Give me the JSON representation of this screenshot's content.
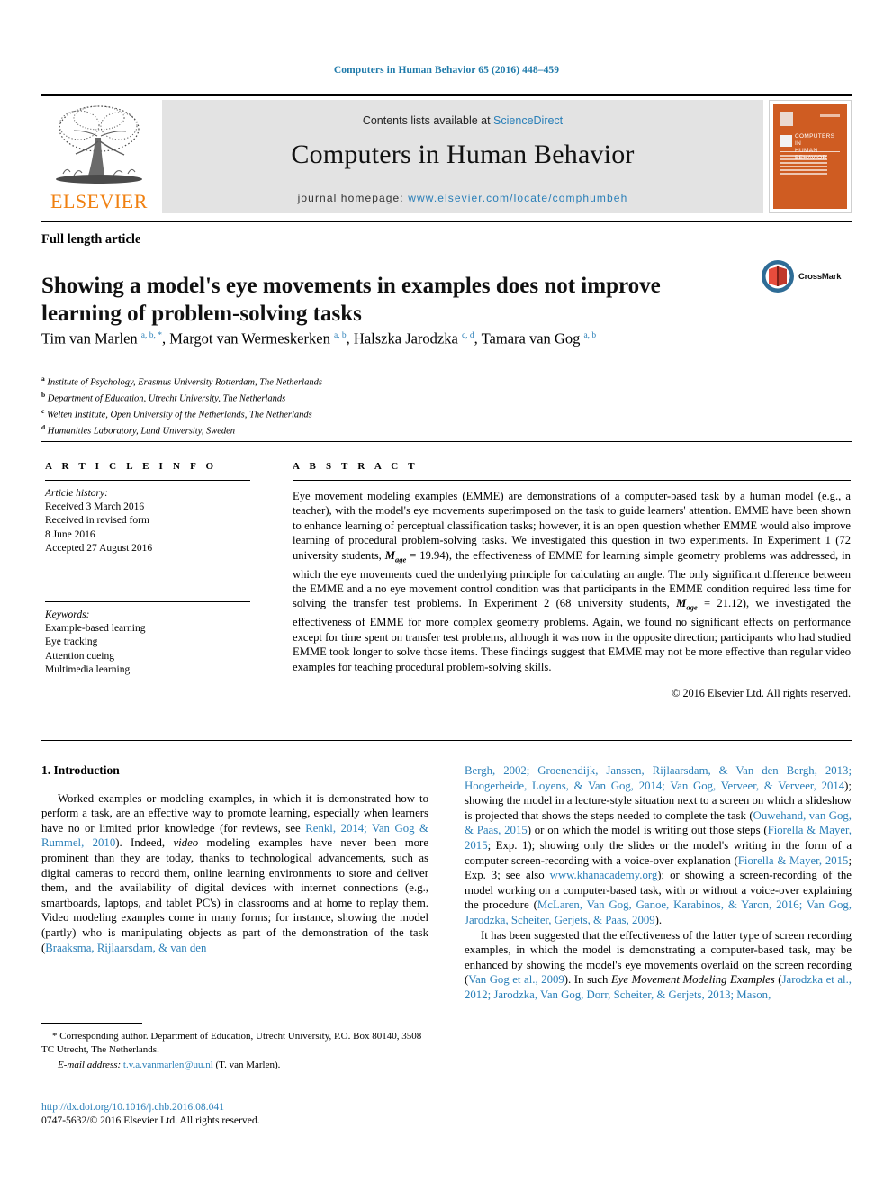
{
  "running_head": "Computers in Human Behavior 65 (2016) 448–459",
  "masthead": {
    "publisher_name": "ELSEVIER",
    "contents_prefix": "Contents lists available at ",
    "contents_link": "ScienceDirect",
    "journal_title": "Computers in Human Behavior",
    "homepage_prefix": "journal homepage: ",
    "homepage_link": "www.elsevier.com/locate/comphumbeh",
    "cover_title_line1": "COMPUTERS IN",
    "cover_title_line2": "HUMAN BEHAVIOR"
  },
  "article": {
    "type": "Full length article",
    "title": "Showing a model's eye movements in examples does not improve learning of problem-solving tasks",
    "crossmark_label": "CrossMark",
    "authors_html": "Tim van Marlen <sup>a, b, *</sup>, Margot van Wermeskerken <sup>a, b</sup>, Halszka Jarodzka <sup>c, d</sup>, Tamara van Gog <sup>a, b</sup>",
    "affiliations": [
      {
        "marker": "a",
        "text": "Institute of Psychology, Erasmus University Rotterdam, The Netherlands"
      },
      {
        "marker": "b",
        "text": "Department of Education, Utrecht University, The Netherlands"
      },
      {
        "marker": "c",
        "text": "Welten Institute, Open University of the Netherlands, The Netherlands"
      },
      {
        "marker": "d",
        "text": "Humanities Laboratory, Lund University, Sweden"
      }
    ]
  },
  "article_info": {
    "heading": "A R T I C L E   I N F O",
    "history_label": "Article history:",
    "history": [
      "Received 3 March 2016",
      "Received in revised form",
      "8 June 2016",
      "Accepted 27 August 2016"
    ],
    "keywords_label": "Keywords:",
    "keywords": [
      "Example-based learning",
      "Eye tracking",
      "Attention cueing",
      "Multimedia learning"
    ]
  },
  "abstract": {
    "heading": "A B S T R A C T",
    "paragraph_1": "Eye movement modeling examples (EMME) are demonstrations of a computer-based task by a human model (e.g., a teacher), with the model's eye movements superimposed on the task to guide learners' attention. EMME have been shown to enhance learning of perceptual classification tasks; however, it is an open question whether EMME would also improve learning of procedural problem-solving tasks. We investigated this question in two experiments. In Experiment 1 (72 university students, ",
    "mage_1_symbol": "M",
    "mage_1_sub": "age",
    "mage_1_value": " = 19.94),",
    "paragraph_2": " the effectiveness of EMME for learning simple geometry problems was addressed, in which the eye movements cued the underlying principle for calculating an angle. The only significant difference between the EMME and a no eye movement control condition was that participants in the EMME condition required less time for solving the transfer test problems. In Experiment 2 (68 university students, ",
    "mage_2_symbol": "M",
    "mage_2_sub": "age",
    "mage_2_value": " = 21.12),",
    "paragraph_3": " we investigated the effectiveness of EMME for more complex geometry problems. Again, we found no significant effects on performance except for time spent on transfer test problems, although it was now in the opposite direction; participants who had studied EMME took longer to solve those items. These findings suggest that EMME may not be more effective than regular video examples for teaching procedural problem-solving skills.",
    "copyright": "© 2016 Elsevier Ltd. All rights reserved."
  },
  "introduction": {
    "section_number_title": "1. Introduction",
    "left_p1_a": "Worked examples or modeling examples, in which it is demonstrated how to perform a task, are an effective way to promote learning, especially when learners have no or limited prior knowledge (for reviews, see ",
    "left_p1_ref1": "Renkl, 2014; Van Gog & Rummel, 2010",
    "left_p1_b": "). Indeed, ",
    "left_p1_it": "video",
    "left_p1_c": " modeling examples have never been more prominent than they are today, thanks to technological advancements, such as digital cameras to record them, online learning environments to store and deliver them, and the availability of digital devices with internet connections (e.g., smartboards, laptops, and tablet PC's) in classrooms and at home to replay them. Video modeling examples come in many forms; for instance, showing the model (partly) who is manipulating objects as part of the demonstration of the task (",
    "left_p1_ref2": "Braaksma, Rijlaarsdam, & van den",
    "right_p1_ref_cont": "Bergh, 2002; Groenendijk, Janssen, Rijlaarsdam, & Van den Bergh, 2013; Hoogerheide, Loyens, & Van Gog, 2014; Van Gog, Verveer, & Verveer, 2014",
    "right_p1_a": "); showing the model in a lecture-style situation next to a screen on which a slideshow is projected that shows the steps needed to complete the task (",
    "right_p1_ref2": "Ouwehand, van Gog, & Paas, 2015",
    "right_p1_b": ") or on which the model is writing out those steps (",
    "right_p1_ref3": "Fiorella & Mayer, 2015",
    "right_p1_c": "; Exp. 1); showing only the slides or the model's writing in the form of a computer screen-recording with a voice-over explanation (",
    "right_p1_ref4": "Fiorella & Mayer, 2015",
    "right_p1_d": "; Exp. 3; see also ",
    "right_p1_ref5": "www.khanacademy.org",
    "right_p1_e": "); or showing a screen-recording of the model working on a computer-based task, with or without a voice-over explaining the procedure (",
    "right_p1_ref6": "McLaren, Van Gog, Ganoe, Karabinos, & Yaron, 2016; Van Gog, Jarodzka, Scheiter, Gerjets, & Paas, 2009",
    "right_p1_f": ").",
    "right_p2_a": "It has been suggested that the effectiveness of the latter type of screen recording examples, in which the model is demonstrating a computer-based task, may be enhanced by showing the model's eye movements overlaid on the screen recording (",
    "right_p2_ref1": "Van Gog et al., 2009",
    "right_p2_b": "). In such ",
    "right_p2_it": "Eye Movement Modeling Examples",
    "right_p2_c": " (",
    "right_p2_ref2": "Jarodzka et al., 2012; Jarodzka, Van Gog, Dorr, Scheiter, & Gerjets, 2013; Mason,"
  },
  "footer": {
    "corresponding_marker": "*",
    "corresponding_text": " Corresponding author. Department of Education, Utrecht University, P.O. Box 80140, 3508 TC Utrecht, The Netherlands.",
    "email_label": "E-mail address:",
    "email_link": "t.v.a.vanmarlen@uu.nl",
    "email_suffix": " (T. van Marlen).",
    "doi_link": "http://dx.doi.org/10.1016/j.chb.2016.08.041",
    "issn_line": "0747-5632/© 2016 Elsevier Ltd. All rights reserved."
  },
  "colors": {
    "link_blue": "#2a7fb8",
    "elsevier_orange": "#f08010",
    "cover_orange": "#cf5c22",
    "band_grey": "#e3e3e3"
  }
}
